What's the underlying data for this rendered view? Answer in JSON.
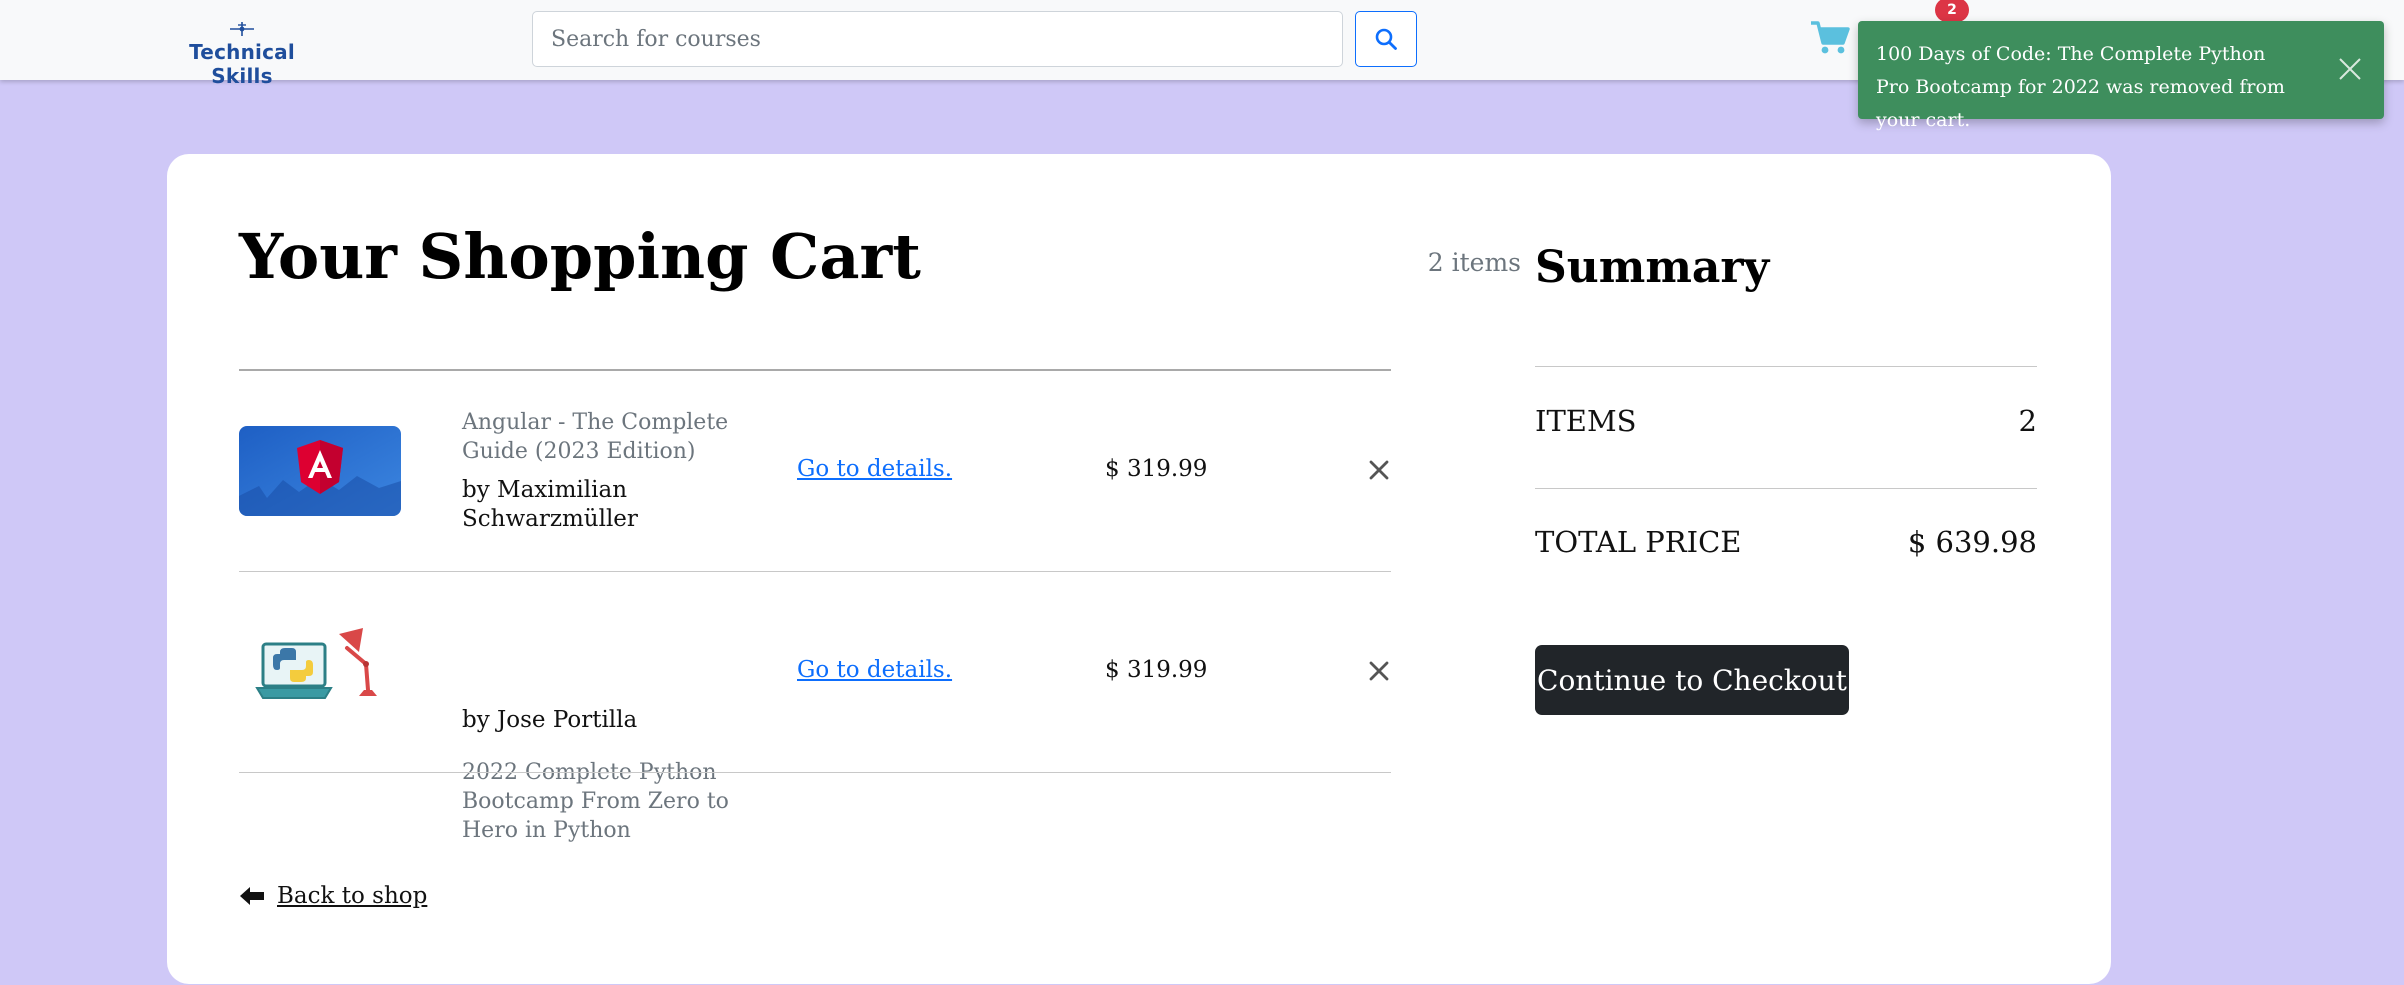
{
  "navbar": {
    "brand_text": "Technical Skills",
    "search_placeholder": "Search for courses",
    "cart_badge": "2"
  },
  "toast": {
    "message": "100 Days of Code: The Complete Python Pro Bootcamp for 2022 was removed from your cart."
  },
  "cart": {
    "title": "Your Shopping Cart",
    "count_label": "2 items",
    "items": [
      {
        "title": "Angular - The Complete Guide (2023 Edition)",
        "author": "by Maximilian Schwarzmüller",
        "link": "Go to details.",
        "price": "$ 319.99",
        "thumbnail_icon": "angular-logo"
      },
      {
        "title": "2022 Complete Python Bootcamp From Zero to Hero in Python",
        "author": "by Jose Portilla",
        "link": "Go to details.",
        "price": "$ 319.99",
        "thumbnail_icon": "python-laptop-lamp"
      }
    ],
    "back_label": "Back to shop"
  },
  "summary": {
    "title": "Summary",
    "items_label": "ITEMS",
    "items_value": "2",
    "total_label": "TOTAL PRICE",
    "total_value": "$ 639.98",
    "checkout_label": "Continue to Checkout"
  },
  "colors": {
    "page_background": "#cfc8f7",
    "brand": "#1f4e9c",
    "toast": "#3e8e5d",
    "link": "#0d6efd",
    "badge": "#dc3545",
    "cart_icon": "#5bc0de",
    "checkout_button": "#212529"
  }
}
